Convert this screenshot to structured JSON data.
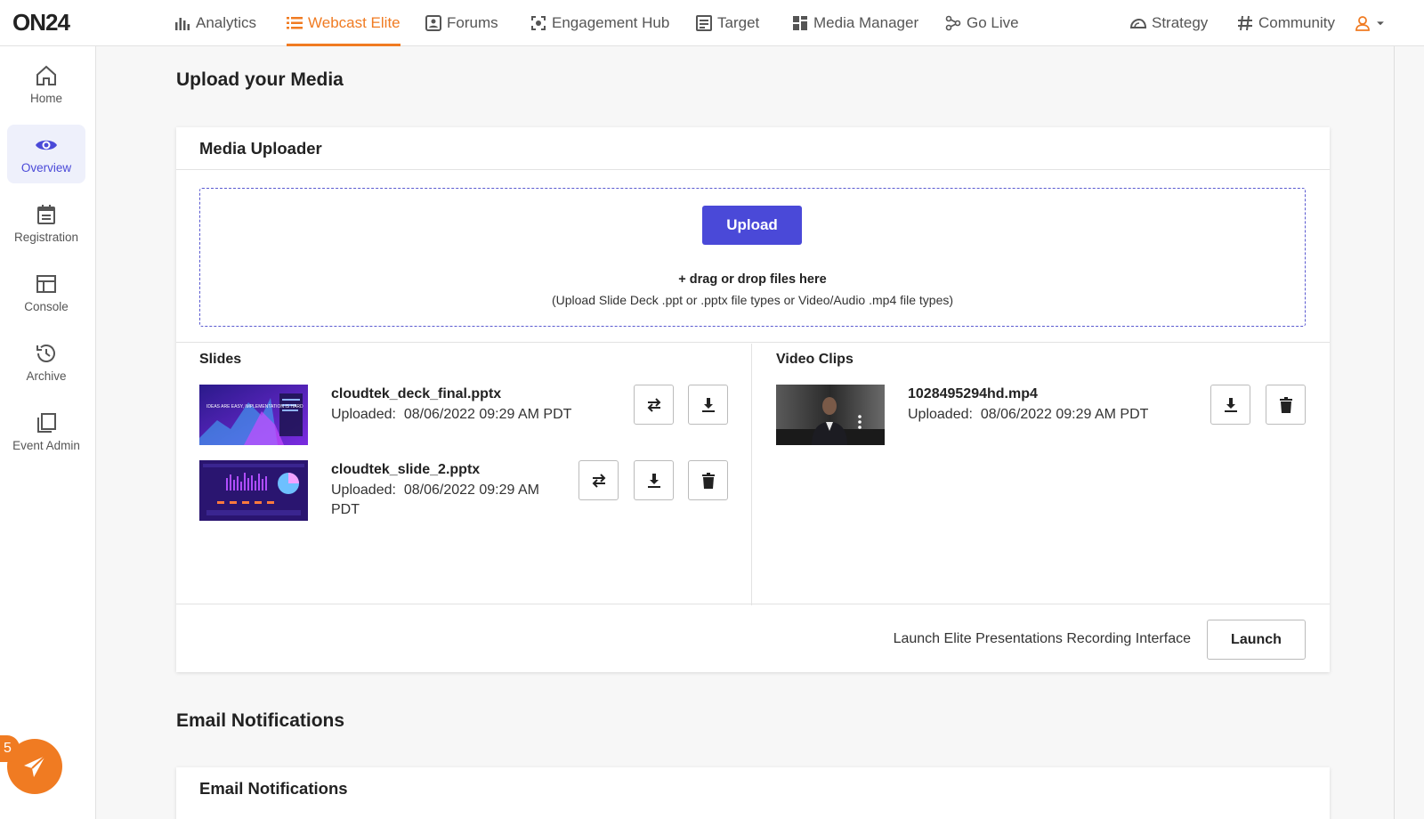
{
  "brand": {
    "logo": "ON24",
    "accent": "#f07b22",
    "primary": "#4a49d8"
  },
  "topnav": {
    "items": [
      {
        "label": "Analytics",
        "icon": "bar-chart-icon"
      },
      {
        "label": "Webcast Elite",
        "icon": "list-icon",
        "active": true
      },
      {
        "label": "Forums",
        "icon": "forums-icon"
      },
      {
        "label": "Engagement Hub",
        "icon": "hub-icon"
      },
      {
        "label": "Target",
        "icon": "target-icon"
      },
      {
        "label": "Media Manager",
        "icon": "grid-icon"
      },
      {
        "label": "Go Live",
        "icon": "go-live-icon"
      },
      {
        "label": "Strategy",
        "icon": "strategy-icon"
      },
      {
        "label": "Community",
        "icon": "hashtag-icon"
      }
    ],
    "user_icon": "user-icon"
  },
  "sidebar": {
    "items": [
      {
        "label": "Home",
        "icon": "home-icon"
      },
      {
        "label": "Overview",
        "icon": "eye-icon",
        "active": true
      },
      {
        "label": "Registration",
        "icon": "calendar-icon"
      },
      {
        "label": "Console",
        "icon": "console-icon"
      },
      {
        "label": "Archive",
        "icon": "history-icon"
      },
      {
        "label": "Event Admin",
        "icon": "pages-icon"
      }
    ],
    "notification_count": "5"
  },
  "page": {
    "title": "Upload your Media"
  },
  "uploader": {
    "title": "Media Uploader",
    "upload_label": "Upload",
    "drag_text": "+ drag or drop files here",
    "hint_text": "(Upload Slide Deck .ppt or .pptx file types or Video/Audio .mp4 file types)",
    "slides_label": "Slides",
    "videos_label": "Video Clips",
    "slides": [
      {
        "name": "cloudtek_deck_final.pptx",
        "uploaded_prefix": "Uploaded:",
        "uploaded_at": "08/06/2022 09:29 AM PDT",
        "thumb_text": "IDEAS ARE EASY, IMPLEMENTATION IS HARD"
      },
      {
        "name": "cloudtek_slide_2.pptx",
        "uploaded_prefix": "Uploaded:",
        "uploaded_at": "08/06/2022 09:29 AM",
        "uploaded_tz": "PDT"
      }
    ],
    "videos": [
      {
        "name": "1028495294hd.mp4",
        "uploaded_prefix": "Uploaded:",
        "uploaded_at": "08/06/2022 09:29 AM PDT"
      }
    ],
    "launch_text": "Launch Elite Presentations Recording Interface",
    "launch_label": "Launch"
  },
  "email": {
    "section_title": "Email Notifications",
    "card_title": "Email Notifications"
  }
}
